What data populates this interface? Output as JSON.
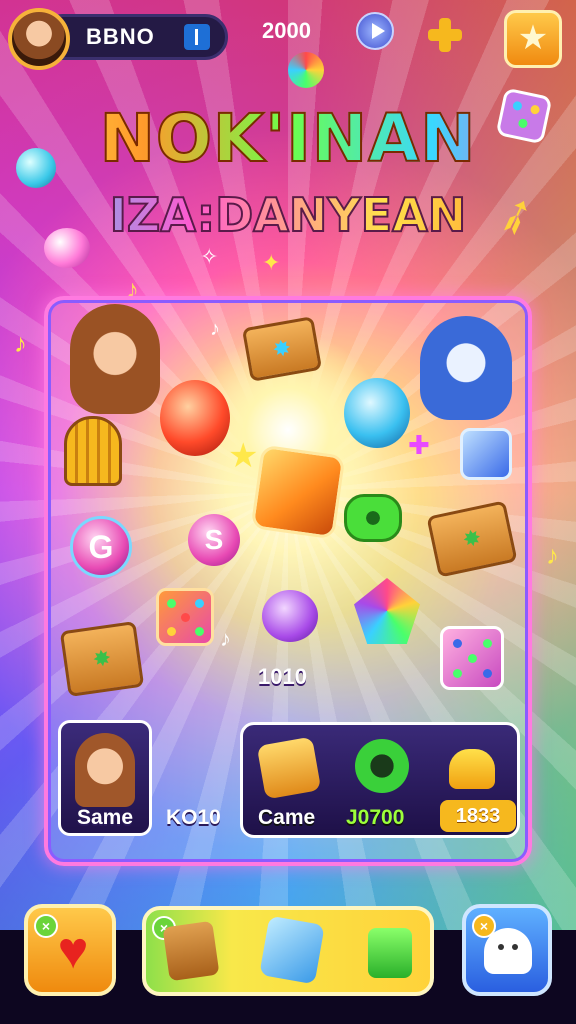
{
  "header": {
    "player_name": "BBNO",
    "score": "2000"
  },
  "title": {
    "line1": "NOK'INAN",
    "line2": "IZA:DANYEAN"
  },
  "board": {
    "center_score": "1010",
    "player_card_label": "Same",
    "player_score": "KO10",
    "opponent_card_label": "Came",
    "opponent_score": "J0700",
    "opponent_badge": "1833"
  },
  "pieces": {
    "orb_letter_1": "G",
    "orb_letter_2": "S"
  },
  "colors": {
    "board_border": "#ff7ae0",
    "gold_button": "#f6b81e",
    "blue_button": "#2a5fe0",
    "green_score": "#9cff3a"
  },
  "icons": {
    "top_right_button": "star-icon",
    "plus_button": "plus-icon",
    "play_button": "play-icon",
    "bottom_left": "heart-icon",
    "bottom_right": "ghost-icon",
    "bottom_center": "powerup-pieces"
  }
}
